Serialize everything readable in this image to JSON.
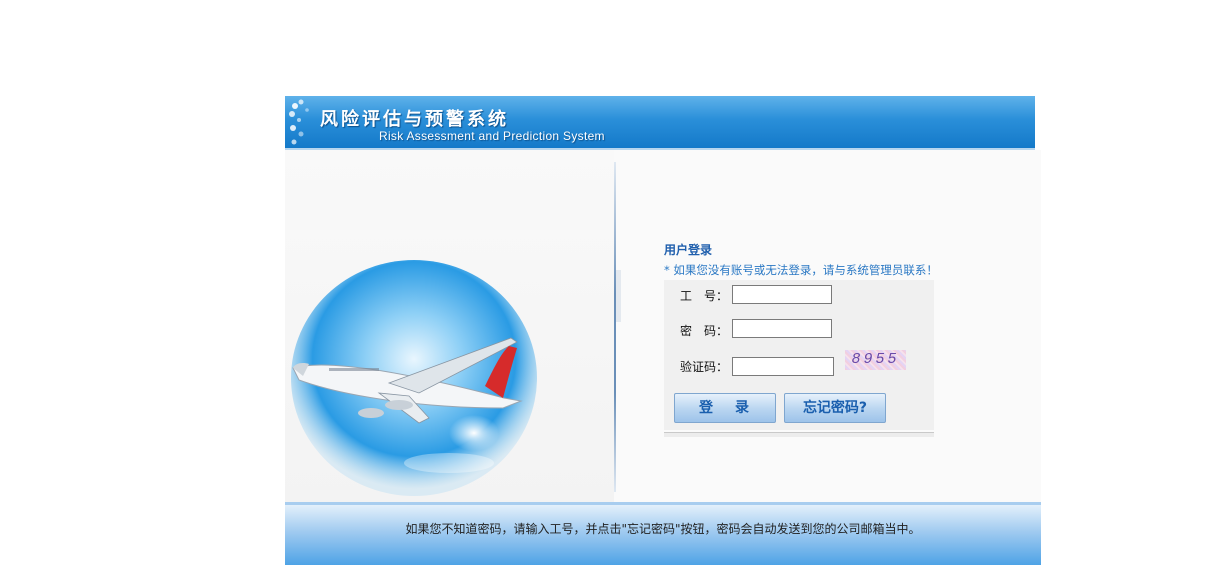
{
  "header": {
    "title": "风险评估与预警系统",
    "subtitle": "Risk Assessment and Prediction System"
  },
  "login": {
    "title": "用户登录",
    "note": "* 如果您没有账号或无法登录，请与系统管理员联系！",
    "fields": {
      "employee_id_label": "工　号：",
      "employee_id_value": "",
      "password_label": "密　码：",
      "password_value": "",
      "captcha_label": "验证码：",
      "captcha_value": ""
    },
    "captcha_code": "8955",
    "login_button": "登录",
    "forgot_button": "忘记密码?"
  },
  "footer": {
    "text": "如果您不知道密码，请输入工号，并点击\"忘记密码\"按钮，密码会自动发送到您的公司邮箱当中。"
  },
  "colors": {
    "header_blue": "#1479c9",
    "link_blue": "#1f5fad",
    "footer_blue": "#4ea3e6"
  },
  "icons": {
    "header_decoration": "dots-decoration-icon",
    "illustration": "airplane-globe-illustration"
  }
}
